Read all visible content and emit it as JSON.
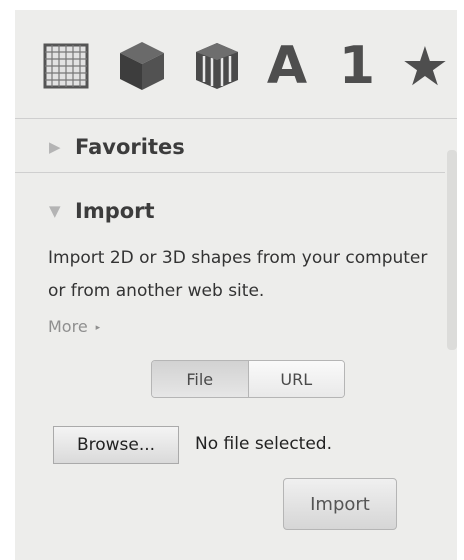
{
  "toolbar": {
    "tools": [
      {
        "icon": "grid-icon"
      },
      {
        "icon": "cube-icon"
      },
      {
        "icon": "cylinder-icon"
      },
      {
        "icon": "letter-icon",
        "glyph": "A"
      },
      {
        "icon": "number-icon",
        "glyph": "1"
      },
      {
        "icon": "star-icon",
        "glyph": "★"
      }
    ]
  },
  "sections": {
    "favorites": {
      "label": "Favorites",
      "collapsed_glyph": "▶"
    },
    "import": {
      "label": "Import",
      "expanded_glyph": "▼"
    }
  },
  "import_panel": {
    "description": "Import 2D or 3D shapes from your computer or from another web site.",
    "more_label": "More",
    "more_arrow": "▸",
    "source_toggle": {
      "options": [
        "File",
        "URL"
      ],
      "selected": "File"
    },
    "browse_label": "Browse...",
    "file_status": "No file selected.",
    "import_button": "Import"
  },
  "colors": {
    "panel_bg": "#ededeb",
    "icon": "#4e4e4e",
    "triangle": "#b4b4b4"
  }
}
